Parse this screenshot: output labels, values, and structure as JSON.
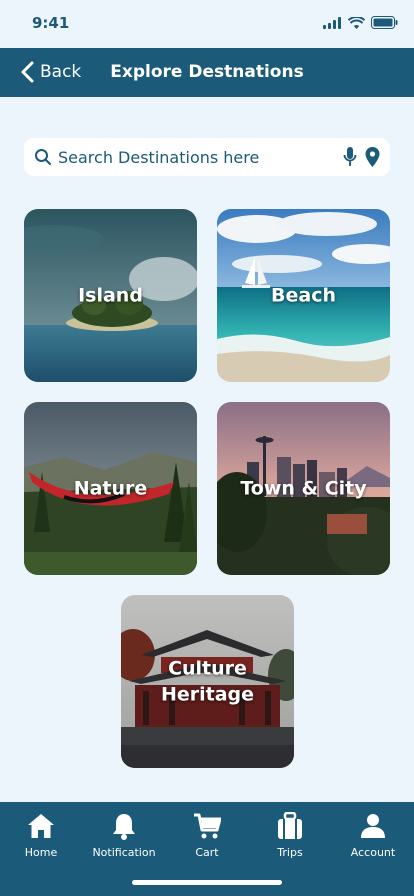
{
  "status": {
    "time": "9:41"
  },
  "header": {
    "back_label": "Back",
    "title": "Explore Destnations"
  },
  "search": {
    "placeholder": "Search Destinations here"
  },
  "categories": [
    {
      "label": "Island"
    },
    {
      "label": "Beach"
    },
    {
      "label": "Nature"
    },
    {
      "label": "Town & City"
    },
    {
      "label_line1": "Culture",
      "label_line2": "Heritage"
    }
  ],
  "nav": [
    {
      "label": "Home",
      "icon": "home-icon"
    },
    {
      "label": "Notification",
      "icon": "bell-icon"
    },
    {
      "label": "Cart",
      "icon": "cart-icon"
    },
    {
      "label": "Trips",
      "icon": "suitcase-icon"
    },
    {
      "label": "Account",
      "icon": "person-icon"
    }
  ],
  "colors": {
    "primary": "#1b5a78",
    "background": "#edf5fc"
  }
}
